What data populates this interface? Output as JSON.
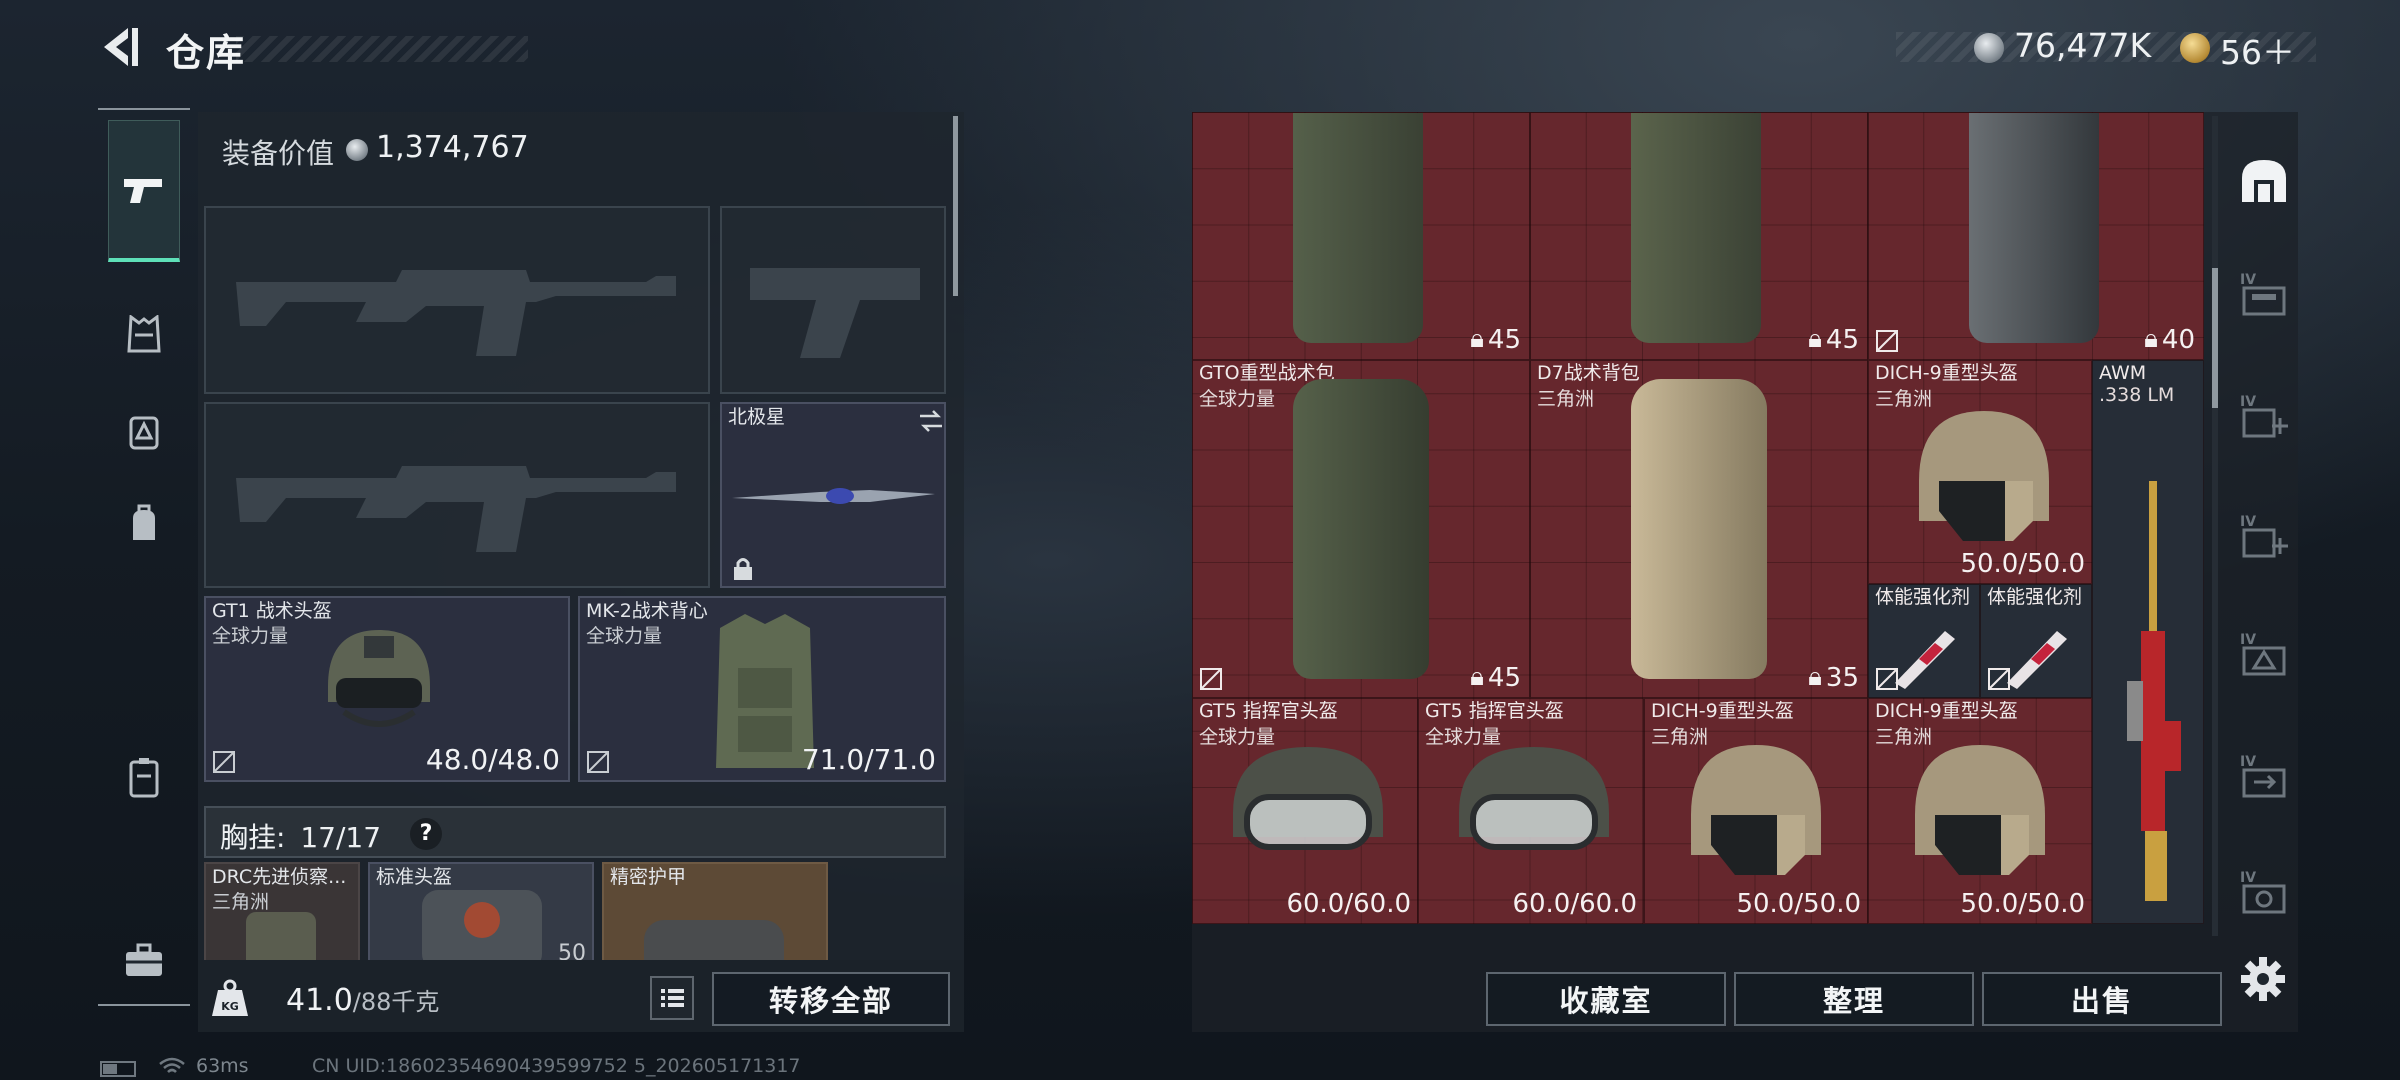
{
  "header": {
    "title": "仓库",
    "silver_balance": "76,477K",
    "gold_balance": "56＋"
  },
  "left_nav": {
    "items": [
      "gun-icon",
      "vest-icon",
      "rig-icon",
      "backpack-icon",
      "case-icon",
      "toolbox-icon"
    ],
    "active": "gun-icon"
  },
  "loadout": {
    "value_label": "装备价值",
    "value": "1,374,767",
    "melee": {
      "name": "北极星"
    },
    "helmet": {
      "name": "GT1 战术头盔",
      "sub": "全球力量",
      "durability": "48.0/48.0"
    },
    "armor": {
      "name": "MK-2战术背心",
      "sub": "全球力量",
      "durability": "71.0/71.0"
    },
    "chest_rig_label": "胸挂:",
    "chest_rig_count": "17/17",
    "chest_rig_help": "?",
    "rig_items": [
      {
        "name": "DRC先进侦察...",
        "sub": "三角洲"
      },
      {
        "name": "标准头盔",
        "sub": "",
        "cap": "50"
      },
      {
        "name": "精密护甲",
        "sub": ""
      }
    ],
    "weight": "41.0",
    "weight_max": "/88千克",
    "transfer_all": "转移全部"
  },
  "inventory": {
    "top_row": [
      {
        "capacity": "45"
      },
      {
        "capacity": "45"
      },
      {
        "capacity": "40"
      }
    ],
    "items": [
      {
        "name": "GTO重型战术包",
        "sub": "全球力量",
        "capacity": "45"
      },
      {
        "name": "D7战术背包",
        "sub": "三角洲",
        "capacity": "35"
      },
      {
        "name": "DICH-9重型头盔",
        "sub": "三角洲",
        "durability": "50.0/50.0"
      },
      {
        "name": "AWM",
        "sub": ".338 LM"
      },
      {
        "name": "体能强化剂",
        "sub": ""
      },
      {
        "name": "体能强化剂",
        "sub": ""
      },
      {
        "name": "GT5 指挥官头盔",
        "sub": "全球力量",
        "durability": "60.0/60.0"
      },
      {
        "name": "GT5 指挥官头盔",
        "sub": "全球力量",
        "durability": "60.0/60.0"
      },
      {
        "name": "DICH-9重型头盔",
        "sub": "三角洲",
        "durability": "50.0/50.0"
      },
      {
        "name": "DICH-9重型头盔",
        "sub": "三角洲",
        "durability": "50.0/50.0"
      }
    ],
    "buttons": {
      "collection": "收藏室",
      "organize": "整理",
      "sell": "出售"
    }
  },
  "right_tabs": [
    "home-icon",
    "storage-1-icon",
    "storage-add-icon",
    "storage-add-2-icon",
    "storage-3-icon",
    "storage-4-icon",
    "storage-5-icon"
  ],
  "footer": {
    "ping": "63ms",
    "uid": "CN UID:18602354690439599752 5_202605171317"
  },
  "colors": {
    "grid_red": "#66272d",
    "accent_green": "#5ee0b8",
    "panel": "#1e262e"
  }
}
